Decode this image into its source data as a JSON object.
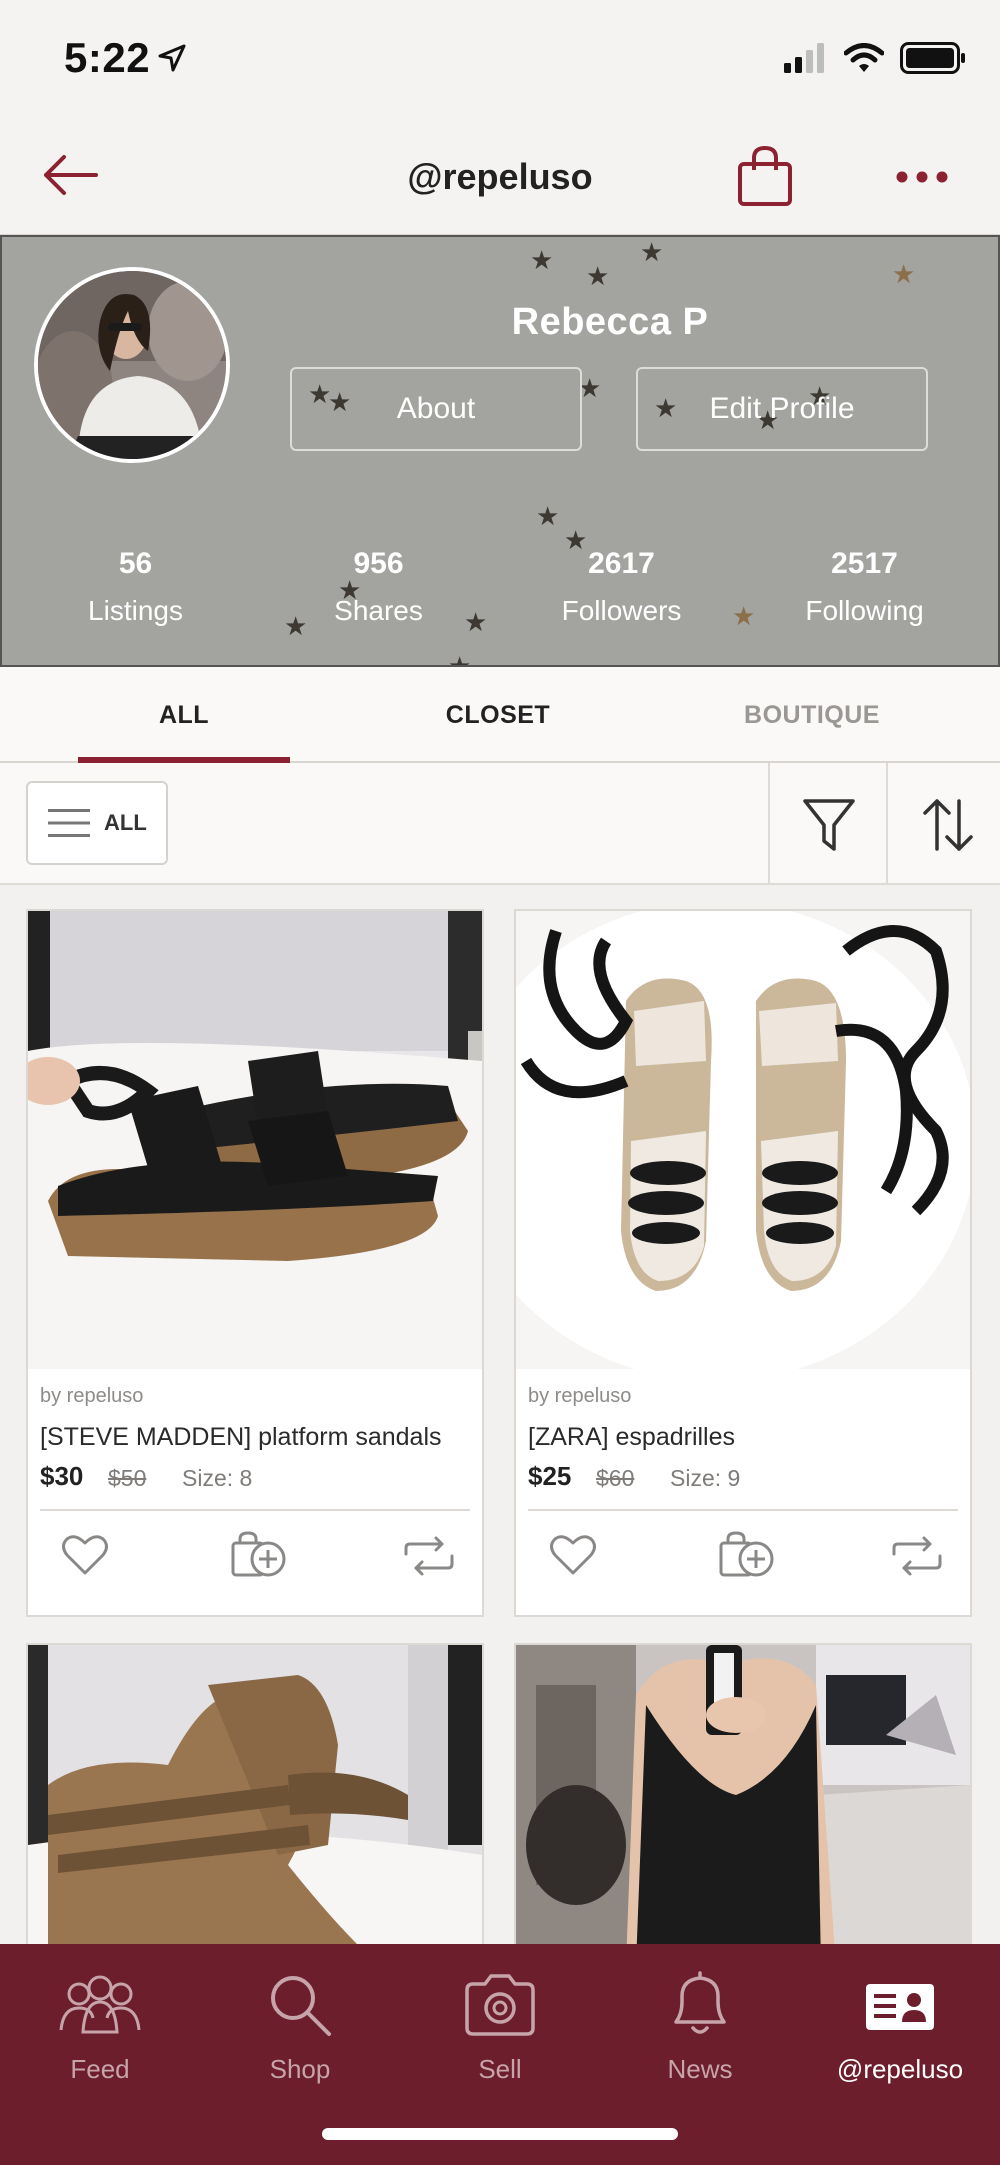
{
  "status_bar": {
    "time": "5:22"
  },
  "nav": {
    "title": "@repeluso"
  },
  "profile": {
    "name": "Rebecca P",
    "about_label": "About",
    "edit_label": "Edit Profile",
    "stats": [
      {
        "value": "56",
        "label": "Listings"
      },
      {
        "value": "956",
        "label": "Shares"
      },
      {
        "value": "2617",
        "label": "Followers"
      },
      {
        "value": "2517",
        "label": "Following"
      }
    ]
  },
  "tabs": {
    "all": "ALL",
    "closet": "CLOSET",
    "boutique": "BOUTIQUE"
  },
  "filter": {
    "all_label": "ALL"
  },
  "listings": [
    {
      "by": "by repeluso",
      "title": "[STEVE MADDEN] platform sandals",
      "price": "$30",
      "original": "$50",
      "size": "Size: 8"
    },
    {
      "by": "by repeluso",
      "title": "[ZARA] espadrilles",
      "price": "$25",
      "original": "$60",
      "size": "Size: 9"
    }
  ],
  "tabbar": {
    "feed": "Feed",
    "shop": "Shop",
    "sell": "Sell",
    "news": "News",
    "profile": "@repeluso"
  },
  "colors": {
    "brand": "#6d1e2c",
    "accent": "#8b2131",
    "header_bg": "#a3a39f"
  },
  "icons": [
    "back-arrow-icon",
    "shopping-bag-icon",
    "more-icon",
    "menu-icon",
    "filter-icon",
    "sort-icon",
    "heart-icon",
    "add-to-bundle-icon",
    "share-icon",
    "feed-icon",
    "search-icon",
    "camera-icon",
    "bell-icon",
    "profile-card-icon"
  ]
}
